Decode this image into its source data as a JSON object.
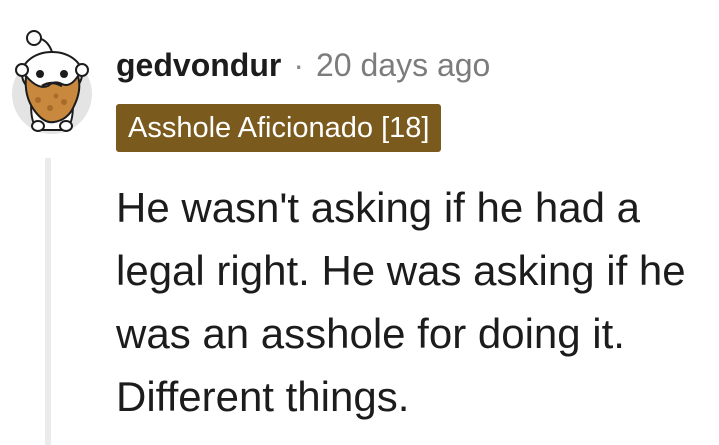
{
  "comment": {
    "username": "gedvondur",
    "separator": "·",
    "timestamp": "20 days ago",
    "flair": "Asshole Aficionado [18]",
    "body": "He wasn't asking if he had a legal right. He was asking if he was an asshole for doing it. Different things.",
    "avatar_icon": "snoo-bearded-avatar-icon"
  },
  "colors": {
    "flair_bg": "#7b5a1e",
    "flair_text": "#ffffff",
    "username": "#1c1c1c",
    "meta": "#7c7c7c",
    "thread_line": "#e9ebed"
  }
}
